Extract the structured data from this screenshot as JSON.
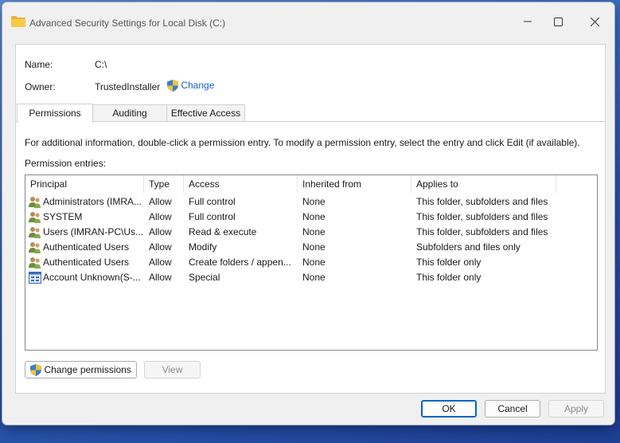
{
  "window": {
    "title": "Advanced Security Settings for Local Disk (C:)"
  },
  "info": {
    "name_label": "Name:",
    "name_value": "C:\\",
    "owner_label": "Owner:",
    "owner_value": "TrustedInstaller",
    "change_link": "Change"
  },
  "tabs": [
    {
      "label": "Permissions",
      "active": true
    },
    {
      "label": "Auditing",
      "active": false
    },
    {
      "label": "Effective Access",
      "active": false
    }
  ],
  "instructions": "For additional information, double-click a permission entry. To modify a permission entry, select the entry and click Edit (if available).",
  "entries_label": "Permission entries:",
  "columns": [
    "Principal",
    "Type",
    "Access",
    "Inherited from",
    "Applies to"
  ],
  "rows": [
    {
      "icon": "users-icon",
      "principal": "Administrators (IMRA...",
      "type": "Allow",
      "access": "Full control",
      "inherited": "None",
      "applies": "This folder, subfolders and files"
    },
    {
      "icon": "users-icon",
      "principal": "SYSTEM",
      "type": "Allow",
      "access": "Full control",
      "inherited": "None",
      "applies": "This folder, subfolders and files"
    },
    {
      "icon": "users-icon",
      "principal": "Users (IMRAN-PC\\Us...",
      "type": "Allow",
      "access": "Read & execute",
      "inherited": "None",
      "applies": "This folder, subfolders and files"
    },
    {
      "icon": "users-icon",
      "principal": "Authenticated Users",
      "type": "Allow",
      "access": "Modify",
      "inherited": "None",
      "applies": "Subfolders and files only"
    },
    {
      "icon": "users-icon",
      "principal": "Authenticated Users",
      "type": "Allow",
      "access": "Create folders / appen...",
      "inherited": "None",
      "applies": "This folder only"
    },
    {
      "icon": "unknown-account-icon",
      "principal": "Account Unknown(S-...",
      "type": "Allow",
      "access": "Special",
      "inherited": "None",
      "applies": "This folder only"
    }
  ],
  "buttons": {
    "change_permissions": "Change permissions",
    "view": "View",
    "ok": "OK",
    "cancel": "Cancel",
    "apply": "Apply"
  },
  "colors": {
    "link": "#1a5ec9",
    "accent": "#0067c0"
  }
}
